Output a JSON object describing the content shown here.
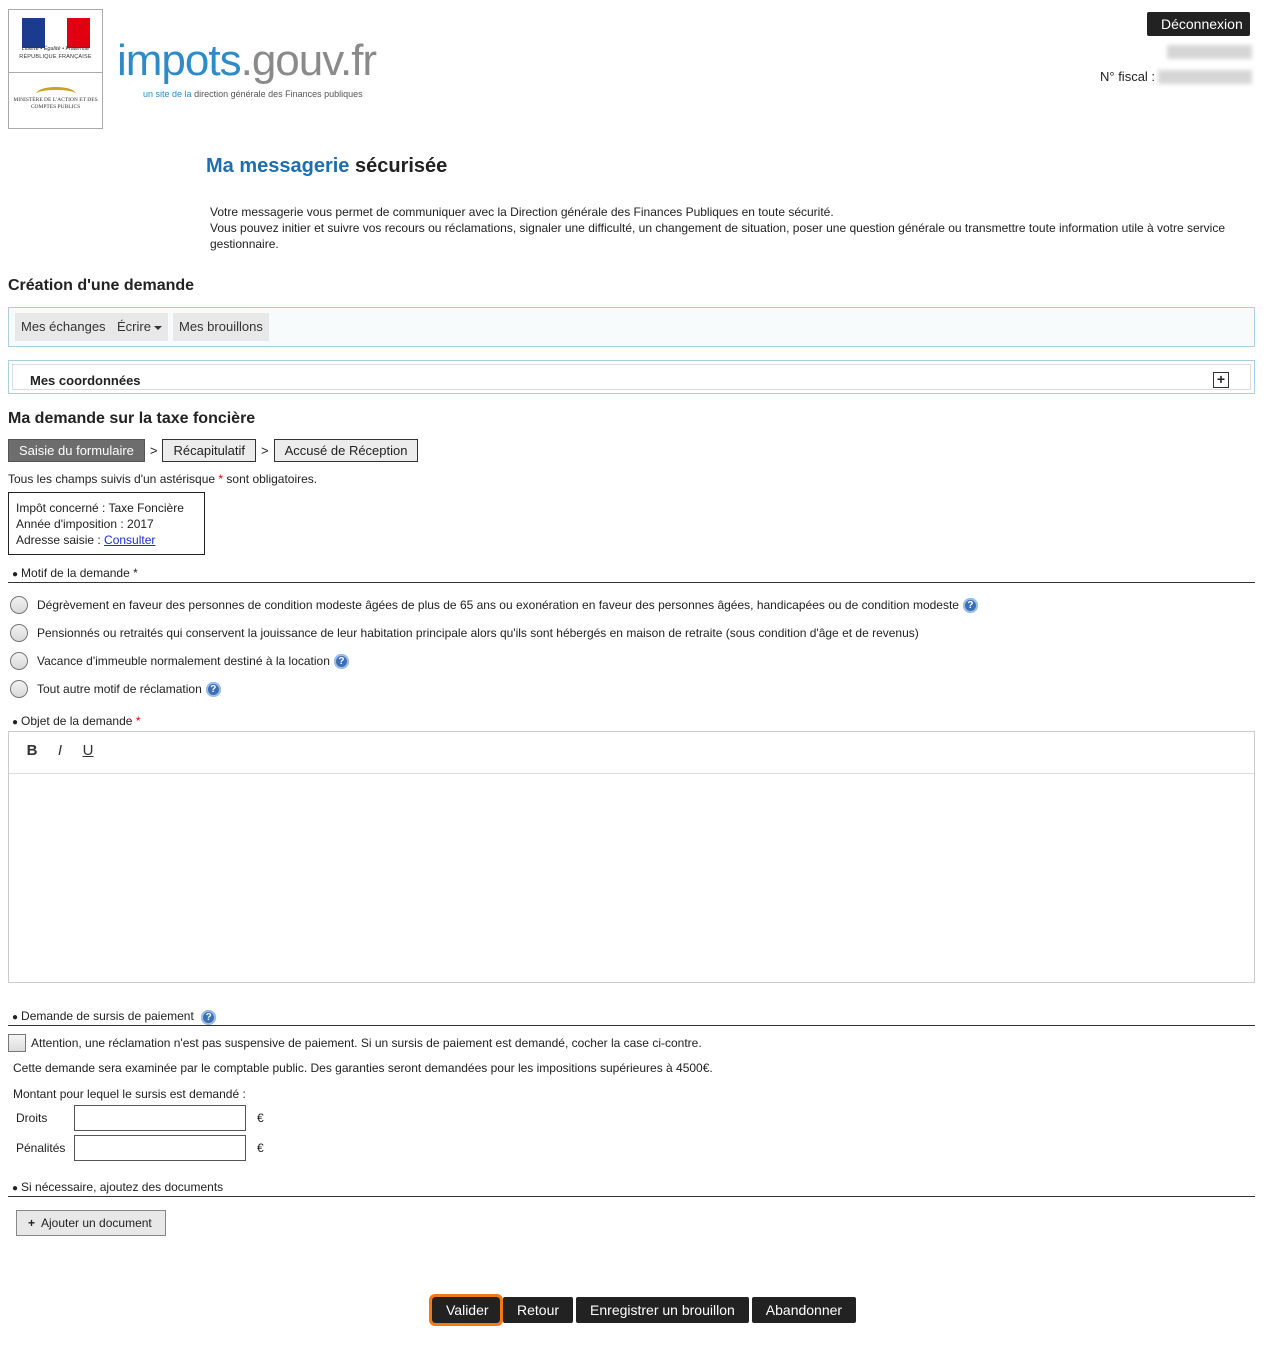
{
  "header": {
    "gov_devise": "Liberté • Égalité • Fraternité",
    "gov_name": "RÉPUBLIQUE FRANÇAISE",
    "ministry": "MINISTÈRE DE L'ACTION ET DES COMPTES PUBLICS",
    "site_name_part1": "impots",
    "site_name_part2": ".gouv.fr",
    "tagline_part1": "un site de la",
    "tagline_part2": "direction générale des Finances publiques",
    "logout_label": "Déconnexion",
    "fiscal_label": "N° fiscal :"
  },
  "page": {
    "title_part1": "Ma messagerie",
    "title_part2": "sécurisée",
    "intro_line1": "Votre messagerie vous permet de communiquer avec la Direction générale des Finances Publiques en toute sécurité.",
    "intro_line2": "Vous pouvez initier et suivre vos recours ou réclamations, signaler une difficulté, un changement de situation, poser une question générale ou transmettre toute information utile à votre service gestionnaire."
  },
  "creation": {
    "heading": "Création d'une demande",
    "nav": [
      "Mes échanges",
      "Écrire",
      "Mes brouillons"
    ],
    "coordonnees_label": "Mes coordonnées",
    "plus": "+"
  },
  "demande": {
    "heading": "Ma demande sur la taxe foncière",
    "steps": [
      "Saisie du formulaire",
      "Récapitulatif",
      "Accusé de Réception"
    ],
    "step_sep": ">",
    "required_note_before": "Tous les champs suivis d'un astérisque",
    "required_note_after": "sont obligatoires.",
    "star": "*",
    "info": {
      "impot": "Impôt concerné : Taxe Foncière",
      "annee": "Année d'imposition : 2017",
      "adresse_label": "Adresse saisie :",
      "adresse_link": "Consulter"
    }
  },
  "motif": {
    "label": "Motif de la demande",
    "star": "*",
    "options": [
      "Dégrèvement en faveur des personnes de condition modeste âgées de plus de 65 ans ou exonération en faveur des personnes âgées, handicapées ou de condition modeste",
      "Pensionnés ou retraités qui conservent la jouissance de leur habitation principale alors qu'ils sont hébergés en maison de retraite (sous condition d'âge et de revenus)",
      "Vacance d'immeuble normalement destiné à la location",
      "Tout autre motif de réclamation"
    ],
    "help": "?"
  },
  "objet": {
    "label": "Objet de la demande",
    "star": "*",
    "toolbar": {
      "bold": "B",
      "italic": "I",
      "underline": "U"
    }
  },
  "sursis": {
    "label": "Demande de sursis de paiement",
    "checkbox_text": "Attention, une réclamation n'est pas suspensive de paiement. Si un sursis de paiement est demandé, cocher la case ci-contre.",
    "note": "Cette demande sera examinée par le comptable public. Des garanties seront demandées pour les impositions supérieures à 4500€.",
    "montant_label": "Montant pour lequel le sursis est demandé :",
    "droits_label": "Droits",
    "droits_value": "",
    "penalites_label": "Pénalités",
    "penalites_value": "",
    "currency": "€"
  },
  "documents": {
    "label": "Si nécessaire, ajoutez des documents",
    "add_button": "Ajouter un document",
    "plus": "+"
  },
  "actions": {
    "valider": "Valider",
    "retour": "Retour",
    "brouillon": "Enregistrer un brouillon",
    "abandonner": "Abandonner"
  },
  "colors": {
    "accent_blue": "#1f6eaf",
    "focus_orange": "#f07a16",
    "button_dark": "#222222"
  }
}
